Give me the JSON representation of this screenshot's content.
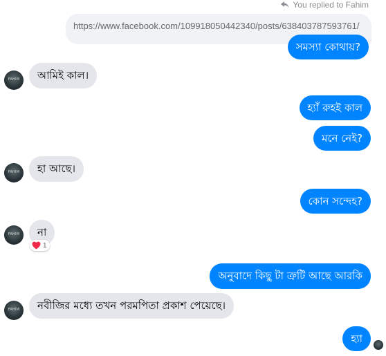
{
  "reply_note": {
    "icon": "reply-arrow-icon",
    "text": "You replied to Fahim"
  },
  "quoted_message": "https://www.facebook.com/109918050442340/posts/638403787593761/",
  "avatar_text": "FAHIM",
  "messages": [
    {
      "sender": "me",
      "text": "সমস্যা কোথায়?"
    },
    {
      "sender": "them",
      "text": "আমিই কাল।"
    },
    {
      "sender": "me",
      "text": "হ্যাঁ রুহই কাল"
    },
    {
      "sender": "me",
      "text": "মনে নেই?"
    },
    {
      "sender": "them",
      "text": "হা আছে।"
    },
    {
      "sender": "me",
      "text": "কোন সন্দেহ?"
    },
    {
      "sender": "them",
      "text": "না",
      "reaction": {
        "icon": "heart-icon",
        "count": "1"
      }
    },
    {
      "sender": "me",
      "text": "অনুবাদে কিছু টা ত্রুটি আছে আরকি"
    },
    {
      "sender": "them",
      "text": "নবীজির মধ্যে তখন পরমপিতা প্রকাশ পেয়েছে।"
    },
    {
      "sender": "me",
      "text": "হ্যা"
    }
  ],
  "colors": {
    "outgoing_bubble": "#0084ff",
    "incoming_bubble": "#e4e6eb",
    "quoted_bubble": "#f0f2f5",
    "reaction_heart": "#f02849"
  }
}
